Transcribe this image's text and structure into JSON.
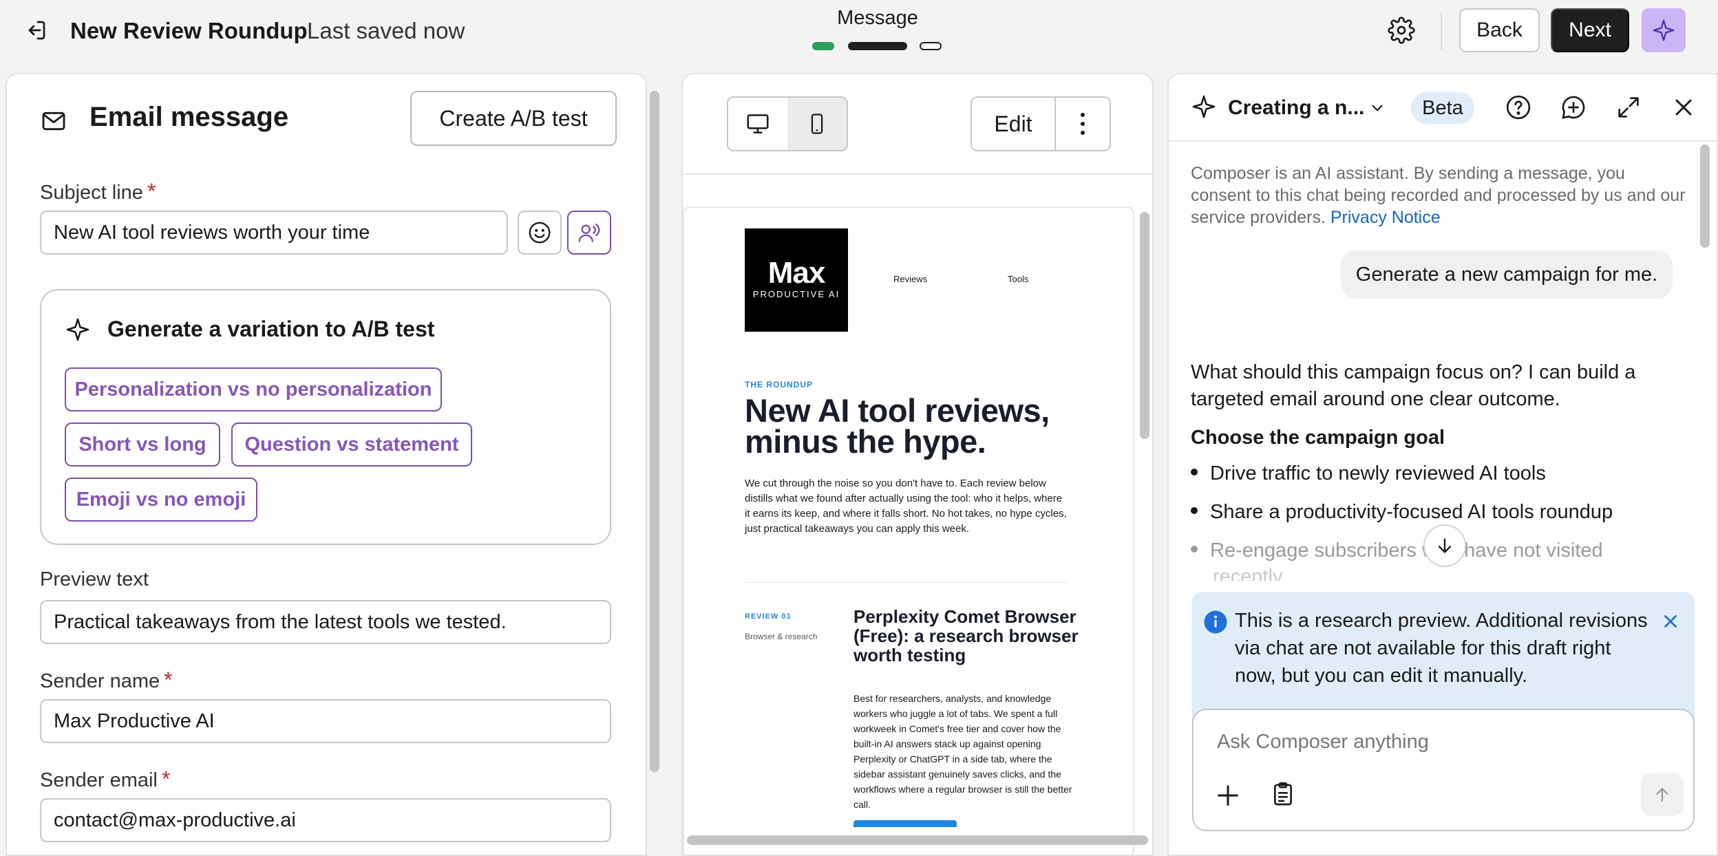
{
  "header": {
    "title": "New Review Roundup",
    "saved_status": "Last saved now",
    "step_label": "Message",
    "steps": [
      {
        "state": "complete",
        "color": "#2e9e5b"
      },
      {
        "state": "current",
        "color": "#1f1f1f"
      },
      {
        "state": "upcoming",
        "color": "#ffffff"
      }
    ],
    "back_label": "Back",
    "next_label": "Next",
    "icons": {
      "exit": "exit-icon",
      "settings": "gear-icon",
      "ai": "sparkle-icon"
    }
  },
  "editor": {
    "heading": "Email message",
    "ab_button": "Create A/B test",
    "subject": {
      "label": "Subject line",
      "required": "*",
      "value": "New AI tool reviews worth your time"
    },
    "variation": {
      "title": "Generate a variation to A/B test",
      "chips": [
        "Personalization vs no personalization",
        "Short vs long",
        "Question vs statement",
        "Emoji vs no emoji"
      ]
    },
    "preview_text": {
      "label": "Preview text",
      "value": "Practical takeaways from the latest tools we tested."
    },
    "sender_name": {
      "label": "Sender name",
      "required": "*",
      "value": "Max Productive AI"
    },
    "sender_email": {
      "label": "Sender email",
      "required": "*",
      "value": "contact@max-productive.ai"
    }
  },
  "preview": {
    "edit_label": "Edit",
    "view_modes": [
      "desktop",
      "mobile"
    ],
    "active_view": "desktop",
    "email": {
      "logo_main": "Max",
      "logo_sub": "PRODUCTIVE AI",
      "nav": [
        "Reviews",
        "Tools"
      ],
      "eyebrow": "THE ROUNDUP",
      "hero": "New AI tool reviews, minus the hype.",
      "intro": "We cut through the noise so you don't have to. Each review below distills what we found after actually using the tool: who it helps, where it earns its keep, and where it falls short. No hot takes, no hype cycles, just practical takeaways you can apply this week.",
      "review": {
        "tag": "REVIEW 01",
        "category": "Browser & research",
        "title": "Perplexity Comet Browser (Free): a research browser worth testing",
        "body": "Best for researchers, analysts, and knowledge workers who juggle a lot of tabs. We spent a full workweek in Comet's free tier and cover how the built-in AI answers stack up against opening Perplexity or ChatGPT in a side tab, where the sidebar assistant genuinely saves clicks, and the workflows where a regular browser is still the better call."
      }
    }
  },
  "composer": {
    "title": "Creating a n...",
    "badge": "Beta",
    "disclaimer": "Composer is an AI assistant. By sending a message, you consent to this chat being recorded and processed by us and our service providers.",
    "privacy_link": "Privacy Notice",
    "user_message": "Generate a new campaign for me.",
    "ai_message": "What should this campaign focus on? I can build a targeted email around one clear outcome.",
    "goal_heading": "Choose the campaign goal",
    "goals": [
      "Drive traffic to newly reviewed AI tools",
      "Share a productivity-focused AI tools roundup",
      "Re-engage subscribers who have not visited"
    ],
    "goal_overflow": "recently",
    "notice": "This is a research preview. Additional revisions via chat are not available for this draft right now, but you can edit it manually.",
    "input_placeholder": "Ask Composer anything"
  }
}
